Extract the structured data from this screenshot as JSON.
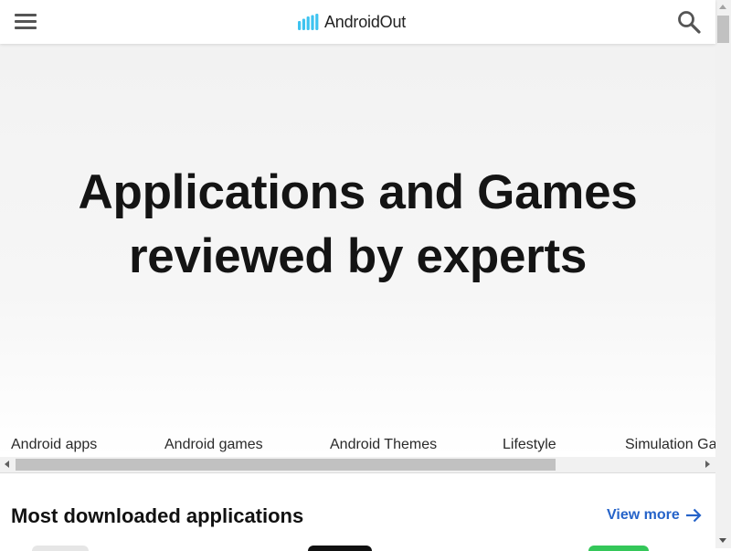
{
  "header": {
    "brand_name": "AndroidOut",
    "menu_icon": "hamburger-menu-icon",
    "search_icon": "search-icon",
    "brand_icon": "signal-bars-logo-icon",
    "brand_icon_color": "#3ec3f0"
  },
  "hero": {
    "title": "Applications and Games reviewed by experts"
  },
  "categories": [
    {
      "label": "Android apps"
    },
    {
      "label": "Android games"
    },
    {
      "label": "Android Themes"
    },
    {
      "label": "Lifestyle"
    },
    {
      "label": "Simulation Games"
    }
  ],
  "section": {
    "title": "Most downloaded applications",
    "view_more": "View more",
    "view_more_color": "#2563c9"
  }
}
